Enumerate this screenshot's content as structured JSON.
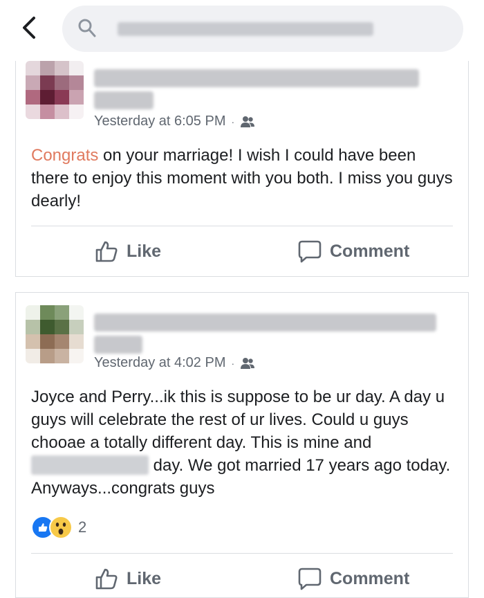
{
  "search": {
    "placeholder": ""
  },
  "posts": [
    {
      "timestamp": "Yesterday at 6:05 PM",
      "separator": "·",
      "body_accent": "Congrats",
      "body_rest": " on your marriage! I wish I could have been there to enjoy this moment with you both. I miss you guys dearly!",
      "actions": {
        "like": "Like",
        "comment": "Comment"
      }
    },
    {
      "timestamp": "Yesterday at 4:02 PM",
      "separator": "·",
      "body_part1": "Joyce and Perry...ik this is suppose to be ur day. A day u guys will celebrate the rest of ur lives. Could u guys chooae a totally different day. This is mine and ",
      "body_part2": " day. We got married 17 years ago today. Anyways...congrats guys",
      "reactions": {
        "count": "2"
      },
      "actions": {
        "like": "Like",
        "comment": "Comment"
      }
    }
  ],
  "colors": {
    "accent": "#e07a5f",
    "like_blue": "#1877f2",
    "wow_yellow": "#f7c948",
    "meta_grey": "#606770"
  },
  "icons": [
    "back-chevron-icon",
    "search-icon",
    "friends-audience-icon",
    "like-thumb-icon",
    "comment-bubble-icon",
    "like-reaction-icon",
    "wow-reaction-icon"
  ]
}
